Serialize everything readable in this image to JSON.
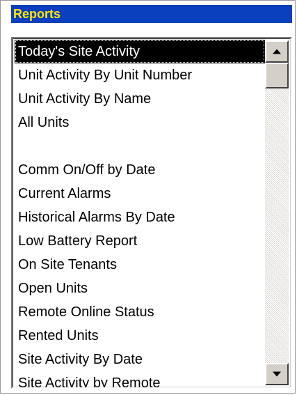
{
  "panel": {
    "title": "Reports",
    "title_color": "#ffe600",
    "title_background": "#0a3fbe"
  },
  "reports": {
    "items": [
      {
        "label": "Today's Site Activity",
        "selected": true
      },
      {
        "label": "Unit Activity By Unit Number",
        "selected": false
      },
      {
        "label": "Unit Activity By Name",
        "selected": false
      },
      {
        "label": "All Units",
        "selected": false
      },
      {
        "label": "",
        "selected": false
      },
      {
        "label": "Comm On/Off by Date",
        "selected": false
      },
      {
        "label": "Current Alarms",
        "selected": false
      },
      {
        "label": "Historical Alarms By Date",
        "selected": false
      },
      {
        "label": "Low Battery Report",
        "selected": false
      },
      {
        "label": "On Site Tenants",
        "selected": false
      },
      {
        "label": "Open Units",
        "selected": false
      },
      {
        "label": "Remote Online Status",
        "selected": false
      },
      {
        "label": "Rented Units",
        "selected": false
      },
      {
        "label": "Site Activity By Date",
        "selected": false
      },
      {
        "label": "Site Activity by Remote",
        "selected": false
      }
    ]
  },
  "scrollbar": {
    "up_icon": "arrow-up-icon",
    "down_icon": "arrow-down-icon",
    "scroll_position": 0.0
  }
}
